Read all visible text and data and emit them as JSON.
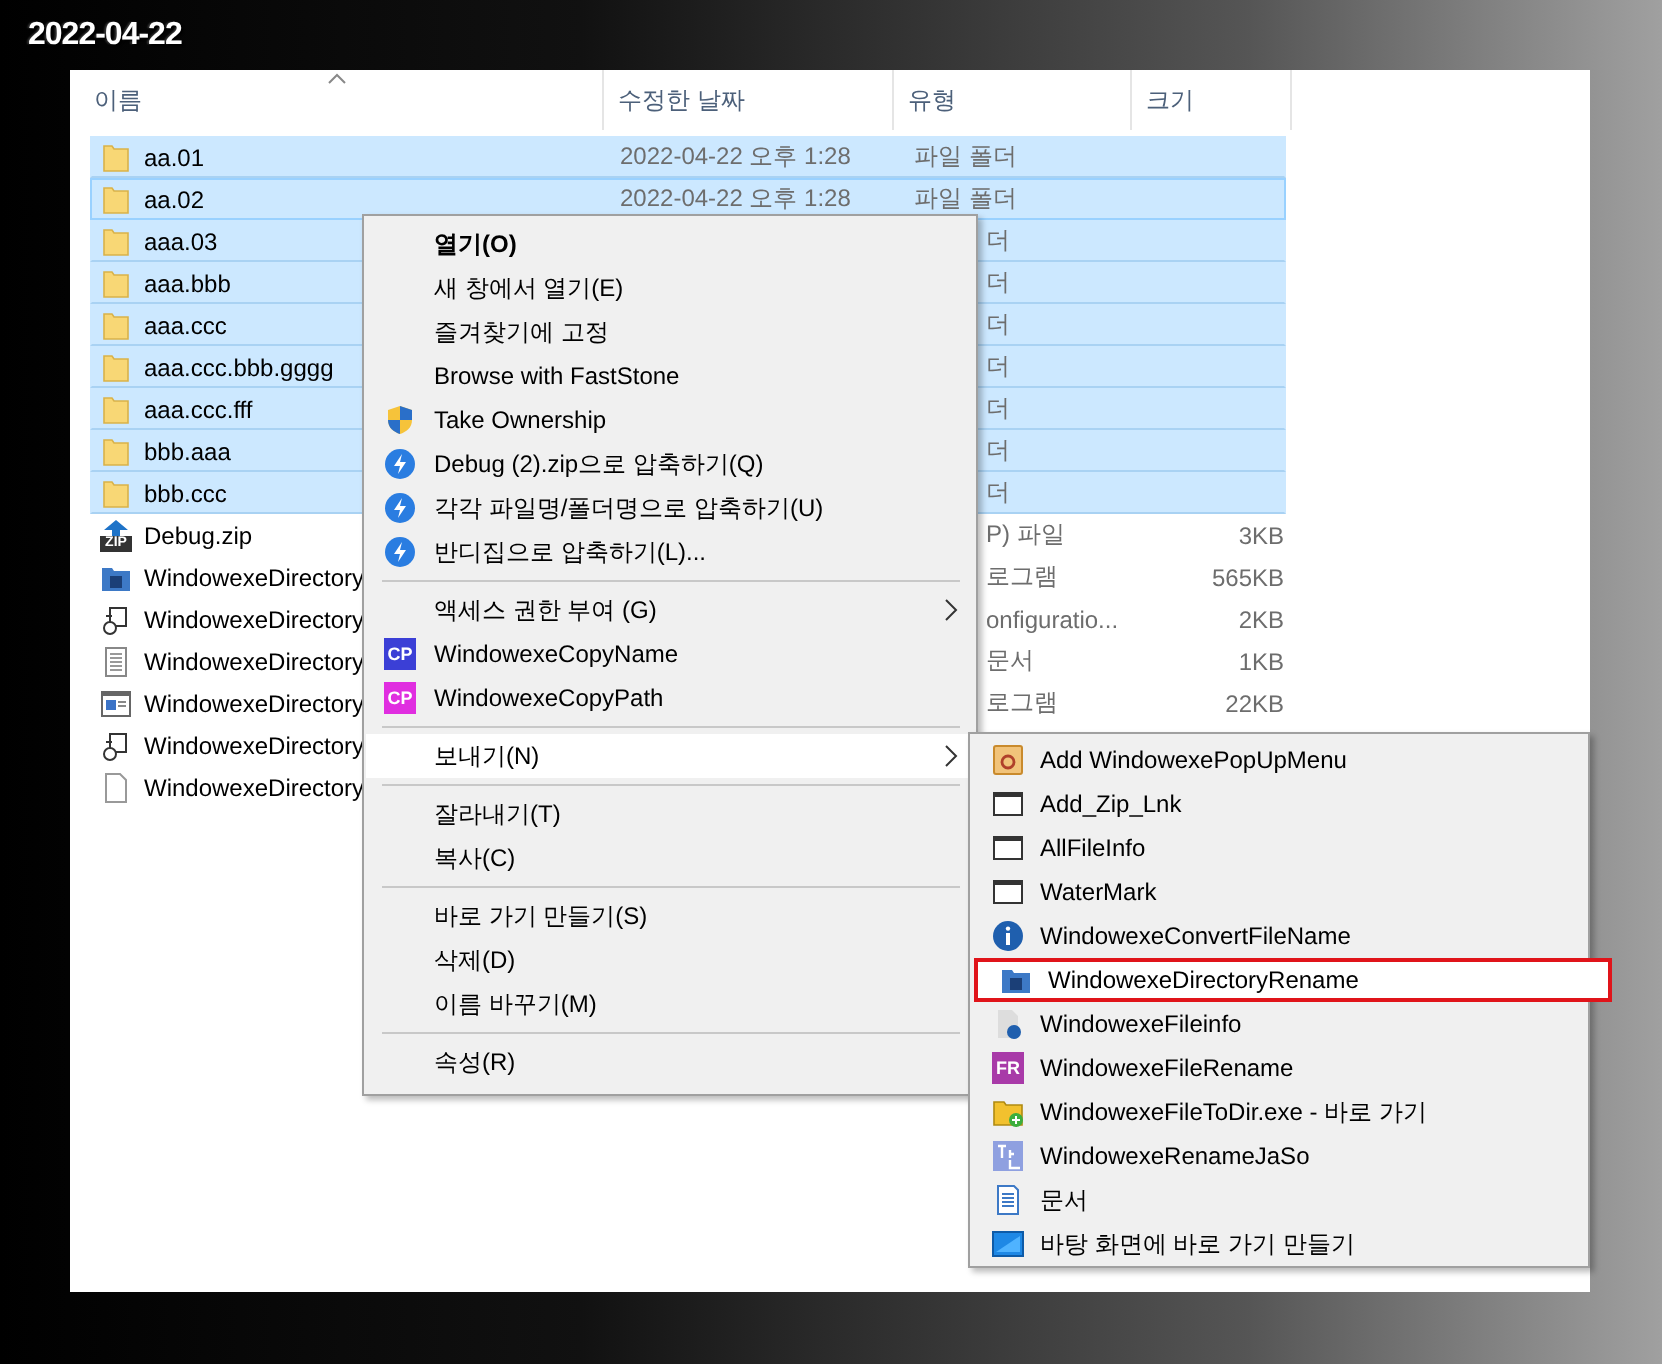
{
  "caption": "2022-04-22",
  "columns": [
    {
      "label": "이름",
      "sorted": true
    },
    {
      "label": "수정한 날짜",
      "sorted": false
    },
    {
      "label": "유형",
      "sorted": false
    },
    {
      "label": "크기",
      "sorted": false
    }
  ],
  "files": [
    {
      "name": "aa.01",
      "kind": "folder",
      "date": "2022-04-22 오후 1:28",
      "type": "파일 폴더",
      "selected": true,
      "focused": false
    },
    {
      "name": "aa.02",
      "kind": "folder",
      "date": "2022-04-22 오후 1:28",
      "type": "파일 폴더",
      "selected": true,
      "focused": true
    },
    {
      "name": "aaa.03",
      "kind": "folder",
      "type": "더",
      "selected": true,
      "focused": false
    },
    {
      "name": "aaa.bbb",
      "kind": "folder",
      "type": "더",
      "selected": true,
      "focused": false
    },
    {
      "name": "aaa.ccc",
      "kind": "folder",
      "type": "더",
      "selected": true,
      "focused": false
    },
    {
      "name": "aaa.ccc.bbb.gggg",
      "kind": "folder",
      "type": "더",
      "selected": true,
      "focused": false
    },
    {
      "name": "aaa.ccc.fff",
      "kind": "folder",
      "type": "더",
      "selected": true,
      "focused": false
    },
    {
      "name": "bbb.aaa",
      "kind": "folder",
      "type": "더",
      "selected": true,
      "focused": false
    },
    {
      "name": "bbb.ccc",
      "kind": "folder",
      "type": "더",
      "selected": true,
      "focused": false
    },
    {
      "name": "Debug.zip",
      "kind": "zip",
      "badge": "ZIP",
      "type": "P) 파일",
      "size": "3KB",
      "selected": false,
      "focused": false
    },
    {
      "name": "WindowexeDirectory",
      "kind": "app",
      "type": "로그램",
      "size": "565KB",
      "selected": false,
      "focused": false
    },
    {
      "name": "WindowexeDirectory",
      "kind": "config",
      "type": "onfiguratio...",
      "size": "2KB",
      "selected": false,
      "focused": false
    },
    {
      "name": "WindowexeDirectory",
      "kind": "text",
      "type": "문서",
      "size": "1KB",
      "selected": false,
      "focused": false
    },
    {
      "name": "WindowexeDirectory",
      "kind": "window",
      "type": "로그램",
      "size": "22KB",
      "selected": false,
      "focused": false
    },
    {
      "name": "WindowexeDirectory",
      "kind": "config",
      "selected": false,
      "focused": false
    },
    {
      "name": "WindowexeDirectory",
      "kind": "file",
      "selected": false,
      "focused": false
    }
  ],
  "context_menu": [
    {
      "kind": "plain",
      "label": "열기(O)",
      "default": true,
      "highlighted": false
    },
    {
      "kind": "plain",
      "label": "새 창에서 열기(E)",
      "default": false,
      "highlighted": false
    },
    {
      "kind": "plain",
      "label": "즐겨찾기에 고정",
      "default": false,
      "highlighted": false
    },
    {
      "kind": "plain",
      "label": "Browse with FastStone",
      "default": false,
      "highlighted": false
    },
    {
      "kind": "shield",
      "label": "Take Ownership",
      "default": false,
      "highlighted": false
    },
    {
      "kind": "zip-tool",
      "label": "Debug (2).zip으로 압축하기(Q)",
      "default": false,
      "highlighted": false
    },
    {
      "kind": "zip-tool",
      "label": "각각 파일명/폴더명으로 압축하기(U)",
      "default": false,
      "highlighted": false
    },
    {
      "kind": "zip-tool",
      "label": "반디집으로 압축하기(L)...",
      "default": false,
      "highlighted": false
    },
    {
      "kind": "separator"
    },
    {
      "kind": "submenu",
      "label": "액세스 권한 부여 (G)",
      "default": false,
      "highlighted": false
    },
    {
      "kind": "badge",
      "badge": "CP",
      "color": "#3b3fd6",
      "label": "WindowexeCopyName",
      "default": false,
      "highlighted": false
    },
    {
      "kind": "badge",
      "badge": "CP",
      "color": "#e02ee0",
      "label": "WindowexeCopyPath",
      "default": false,
      "highlighted": false
    },
    {
      "kind": "separator"
    },
    {
      "kind": "submenu",
      "label": "보내기(N)",
      "default": false,
      "highlighted": true
    },
    {
      "kind": "separator"
    },
    {
      "kind": "plain",
      "label": "잘라내기(T)",
      "default": false,
      "highlighted": false
    },
    {
      "kind": "plain",
      "label": "복사(C)",
      "default": false,
      "highlighted": false
    },
    {
      "kind": "separator"
    },
    {
      "kind": "plain",
      "label": "바로 가기 만들기(S)",
      "default": false,
      "highlighted": false
    },
    {
      "kind": "plain",
      "label": "삭제(D)",
      "default": false,
      "highlighted": false
    },
    {
      "kind": "plain",
      "label": "이름 바꾸기(M)",
      "default": false,
      "highlighted": false
    },
    {
      "kind": "separator"
    },
    {
      "kind": "plain",
      "label": "속성(R)",
      "default": false,
      "highlighted": false
    }
  ],
  "send_to_menu": [
    {
      "kind": "app",
      "label": "Add WindowexePopUpMenu",
      "highlighted": false,
      "outlined": false
    },
    {
      "kind": "window",
      "label": "Add_Zip_Lnk",
      "highlighted": false,
      "outlined": false
    },
    {
      "kind": "window",
      "label": "AllFileInfo",
      "highlighted": false,
      "outlined": false
    },
    {
      "kind": "window",
      "label": "WaterMark",
      "highlighted": false,
      "outlined": false
    },
    {
      "kind": "info",
      "label": "WindowexeConvertFileName",
      "highlighted": false,
      "outlined": false
    },
    {
      "kind": "folder",
      "label": "WindowexeDirectoryRename",
      "highlighted": true,
      "outlined": true
    },
    {
      "kind": "file-info",
      "label": "WindowexeFileinfo",
      "highlighted": false,
      "outlined": false
    },
    {
      "kind": "badge",
      "badge": "FR",
      "color": "#a83aa8",
      "label": "WindowexeFileRename",
      "highlighted": false,
      "outlined": false
    },
    {
      "kind": "folder-add",
      "label": "WindowexeFileToDir.exe - 바로 가기",
      "highlighted": false,
      "outlined": false
    },
    {
      "kind": "letters",
      "label": "WindowexeRenameJaSo",
      "highlighted": false,
      "outlined": false
    },
    {
      "kind": "document",
      "label": "문서",
      "highlighted": false,
      "outlined": false
    },
    {
      "kind": "desktop",
      "label": "바탕 화면에 바로 가기 만들기",
      "highlighted": false,
      "outlined": false
    }
  ]
}
